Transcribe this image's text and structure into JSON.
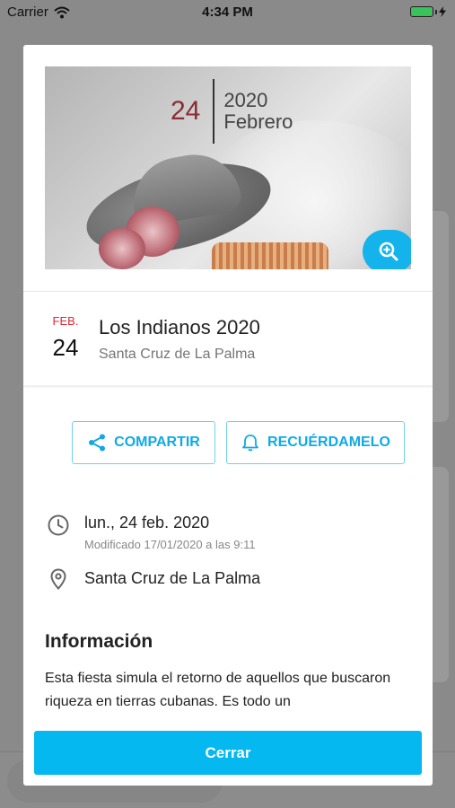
{
  "status_bar": {
    "carrier": "Carrier",
    "time": "4:34 PM"
  },
  "modal": {
    "image": {
      "day": "24",
      "year": "2020",
      "month": "Febrero"
    },
    "event": {
      "month_abbr": "FEB.",
      "day": "24",
      "title": "Los Indianos 2020",
      "place": "Santa Cruz de La Palma"
    },
    "actions": {
      "share_label": "COMPARTIR",
      "remind_label": "RECUÉRDAMELO"
    },
    "details": {
      "date": "lun., 24 feb. 2020",
      "modified": "Modificado 17/01/2020 a las 9:11",
      "location": "Santa Cruz de La Palma"
    },
    "info": {
      "title": "Información",
      "text": "Esta fiesta simula el retorno de aquellos que buscaron riqueza en tierras cubanas. Es todo un"
    },
    "close_label": "Cerrar"
  },
  "colors": {
    "accent": "#05b8ef",
    "date_red": "#e1262f",
    "hero_day": "#8b2b33"
  },
  "icons": [
    "wifi-icon",
    "battery-icon",
    "zoom-in-icon",
    "share-icon",
    "bell-icon",
    "clock-icon",
    "location-pin-icon"
  ]
}
